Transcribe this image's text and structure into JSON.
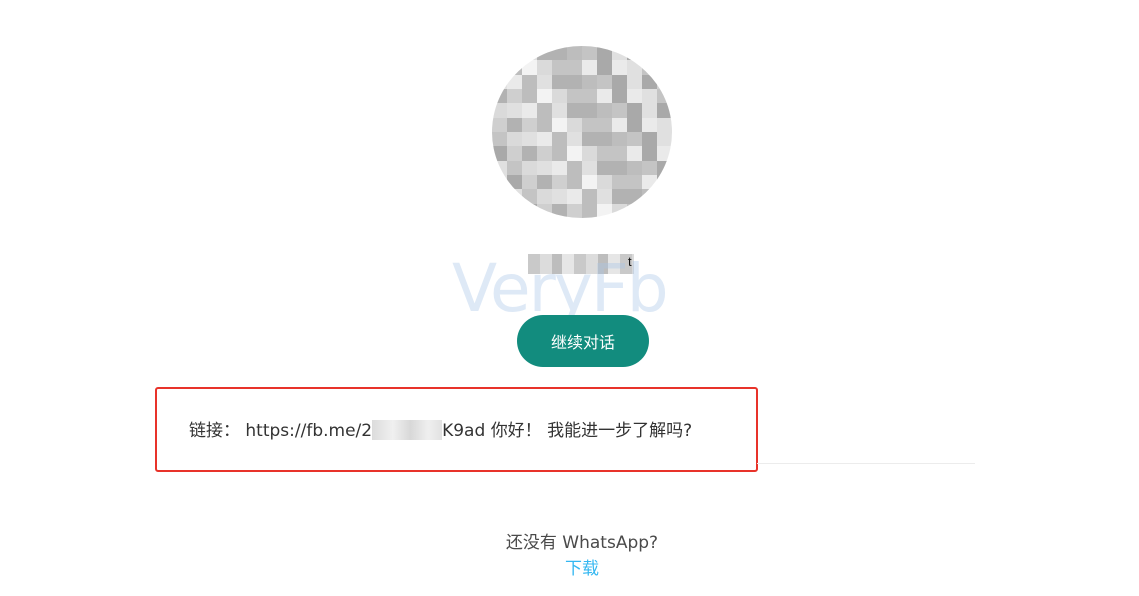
{
  "watermark": "VeryFb",
  "profile": {
    "name_mark": "t"
  },
  "continue_button": "继续对话",
  "link": {
    "prefix": "链接：",
    "url_start": "https://fb.me/2",
    "url_end": "K9ad",
    "message": "你好！ 我能进一步了解吗?"
  },
  "footer": {
    "no_whatsapp": "还没有 WhatsApp?",
    "download": "下载"
  },
  "colors": {
    "brand_green": "#128c7e",
    "link_blue": "#34b7f1",
    "highlight_red": "#e8332a"
  }
}
